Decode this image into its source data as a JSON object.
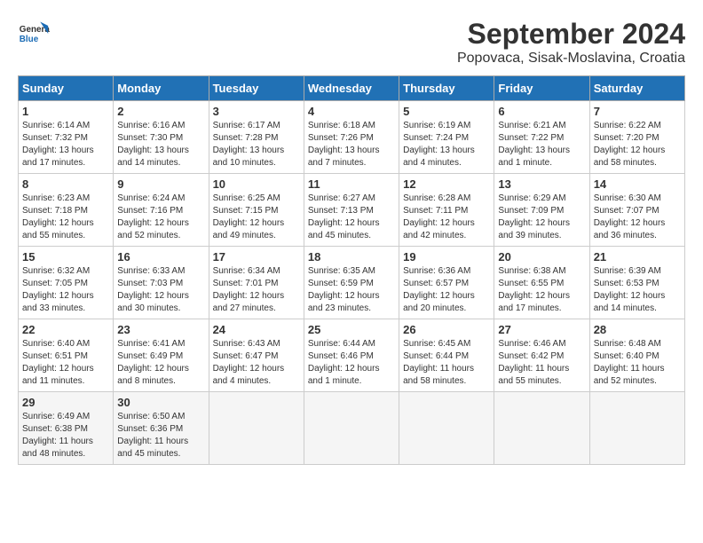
{
  "header": {
    "logo_line1": "General",
    "logo_line2": "Blue",
    "title": "September 2024",
    "subtitle": "Popovaca, Sisak-Moslavina, Croatia"
  },
  "weekdays": [
    "Sunday",
    "Monday",
    "Tuesday",
    "Wednesday",
    "Thursday",
    "Friday",
    "Saturday"
  ],
  "days": [
    {
      "num": "",
      "info": ""
    },
    {
      "num": "",
      "info": ""
    },
    {
      "num": "",
      "info": ""
    },
    {
      "num": "",
      "info": ""
    },
    {
      "num": "",
      "info": ""
    },
    {
      "num": "",
      "info": ""
    },
    {
      "num": "",
      "info": ""
    },
    {
      "num": "1",
      "info": "Sunrise: 6:14 AM\nSunset: 7:32 PM\nDaylight: 13 hours and 17 minutes."
    },
    {
      "num": "2",
      "info": "Sunrise: 6:16 AM\nSunset: 7:30 PM\nDaylight: 13 hours and 14 minutes."
    },
    {
      "num": "3",
      "info": "Sunrise: 6:17 AM\nSunset: 7:28 PM\nDaylight: 13 hours and 10 minutes."
    },
    {
      "num": "4",
      "info": "Sunrise: 6:18 AM\nSunset: 7:26 PM\nDaylight: 13 hours and 7 minutes."
    },
    {
      "num": "5",
      "info": "Sunrise: 6:19 AM\nSunset: 7:24 PM\nDaylight: 13 hours and 4 minutes."
    },
    {
      "num": "6",
      "info": "Sunrise: 6:21 AM\nSunset: 7:22 PM\nDaylight: 13 hours and 1 minute."
    },
    {
      "num": "7",
      "info": "Sunrise: 6:22 AM\nSunset: 7:20 PM\nDaylight: 12 hours and 58 minutes."
    },
    {
      "num": "8",
      "info": "Sunrise: 6:23 AM\nSunset: 7:18 PM\nDaylight: 12 hours and 55 minutes."
    },
    {
      "num": "9",
      "info": "Sunrise: 6:24 AM\nSunset: 7:16 PM\nDaylight: 12 hours and 52 minutes."
    },
    {
      "num": "10",
      "info": "Sunrise: 6:25 AM\nSunset: 7:15 PM\nDaylight: 12 hours and 49 minutes."
    },
    {
      "num": "11",
      "info": "Sunrise: 6:27 AM\nSunset: 7:13 PM\nDaylight: 12 hours and 45 minutes."
    },
    {
      "num": "12",
      "info": "Sunrise: 6:28 AM\nSunset: 7:11 PM\nDaylight: 12 hours and 42 minutes."
    },
    {
      "num": "13",
      "info": "Sunrise: 6:29 AM\nSunset: 7:09 PM\nDaylight: 12 hours and 39 minutes."
    },
    {
      "num": "14",
      "info": "Sunrise: 6:30 AM\nSunset: 7:07 PM\nDaylight: 12 hours and 36 minutes."
    },
    {
      "num": "15",
      "info": "Sunrise: 6:32 AM\nSunset: 7:05 PM\nDaylight: 12 hours and 33 minutes."
    },
    {
      "num": "16",
      "info": "Sunrise: 6:33 AM\nSunset: 7:03 PM\nDaylight: 12 hours and 30 minutes."
    },
    {
      "num": "17",
      "info": "Sunrise: 6:34 AM\nSunset: 7:01 PM\nDaylight: 12 hours and 27 minutes."
    },
    {
      "num": "18",
      "info": "Sunrise: 6:35 AM\nSunset: 6:59 PM\nDaylight: 12 hours and 23 minutes."
    },
    {
      "num": "19",
      "info": "Sunrise: 6:36 AM\nSunset: 6:57 PM\nDaylight: 12 hours and 20 minutes."
    },
    {
      "num": "20",
      "info": "Sunrise: 6:38 AM\nSunset: 6:55 PM\nDaylight: 12 hours and 17 minutes."
    },
    {
      "num": "21",
      "info": "Sunrise: 6:39 AM\nSunset: 6:53 PM\nDaylight: 12 hours and 14 minutes."
    },
    {
      "num": "22",
      "info": "Sunrise: 6:40 AM\nSunset: 6:51 PM\nDaylight: 12 hours and 11 minutes."
    },
    {
      "num": "23",
      "info": "Sunrise: 6:41 AM\nSunset: 6:49 PM\nDaylight: 12 hours and 8 minutes."
    },
    {
      "num": "24",
      "info": "Sunrise: 6:43 AM\nSunset: 6:47 PM\nDaylight: 12 hours and 4 minutes."
    },
    {
      "num": "25",
      "info": "Sunrise: 6:44 AM\nSunset: 6:46 PM\nDaylight: 12 hours and 1 minute."
    },
    {
      "num": "26",
      "info": "Sunrise: 6:45 AM\nSunset: 6:44 PM\nDaylight: 11 hours and 58 minutes."
    },
    {
      "num": "27",
      "info": "Sunrise: 6:46 AM\nSunset: 6:42 PM\nDaylight: 11 hours and 55 minutes."
    },
    {
      "num": "28",
      "info": "Sunrise: 6:48 AM\nSunset: 6:40 PM\nDaylight: 11 hours and 52 minutes."
    },
    {
      "num": "29",
      "info": "Sunrise: 6:49 AM\nSunset: 6:38 PM\nDaylight: 11 hours and 48 minutes."
    },
    {
      "num": "30",
      "info": "Sunrise: 6:50 AM\nSunset: 6:36 PM\nDaylight: 11 hours and 45 minutes."
    },
    {
      "num": "",
      "info": ""
    },
    {
      "num": "",
      "info": ""
    },
    {
      "num": "",
      "info": ""
    },
    {
      "num": "",
      "info": ""
    },
    {
      "num": "",
      "info": ""
    }
  ]
}
